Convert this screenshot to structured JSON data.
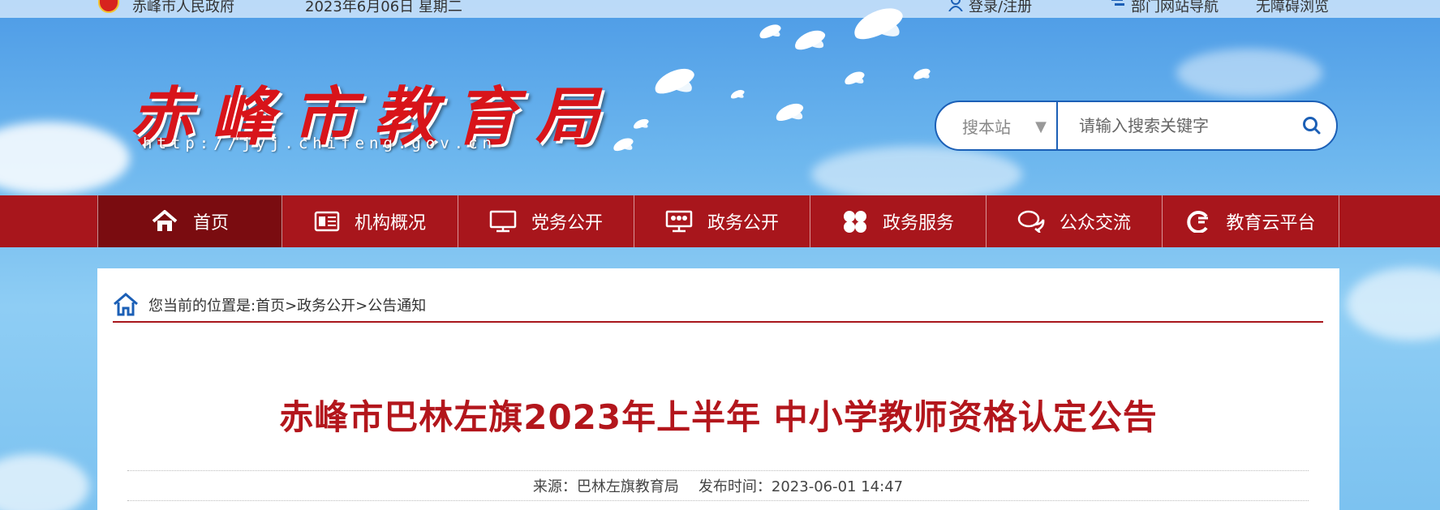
{
  "topbar": {
    "gov_link": "赤峰市人民政府",
    "date": "2023年6月06日 星期二",
    "login": "登录/注册",
    "dept_nav": "部门网站导航",
    "accessible": "无障碍浏览"
  },
  "header": {
    "logo_text": "赤峰市教育局",
    "url_text": "http://jyj.chifeng.gov.cn"
  },
  "search": {
    "scope": "搜本站",
    "placeholder": "请输入搜索关键字"
  },
  "nav": {
    "items": [
      {
        "label": "首页",
        "icon": "home-icon"
      },
      {
        "label": "机构概况",
        "icon": "org-icon"
      },
      {
        "label": "党务公开",
        "icon": "monitor-icon"
      },
      {
        "label": "政务公开",
        "icon": "people-board-icon"
      },
      {
        "label": "政务服务",
        "icon": "grid-icon"
      },
      {
        "label": "公众交流",
        "icon": "chat-icon"
      },
      {
        "label": "教育云平台",
        "icon": "cloud-icon"
      }
    ]
  },
  "breadcrumb": {
    "prefix": "您当前的位置是:",
    "items": [
      "首页",
      "政务公开",
      "公告通知"
    ],
    "separator": ">"
  },
  "article": {
    "title": "赤峰市巴林左旗2023年上半年 中小学教师资格认定公告",
    "source_label": "来源：巴林左旗教育局",
    "publish_label": "发布时间：2023-06-01 14:47"
  },
  "colors": {
    "accent_red": "#a8161c",
    "title_red": "#b3161c",
    "search_blue": "#1b5fb6"
  }
}
